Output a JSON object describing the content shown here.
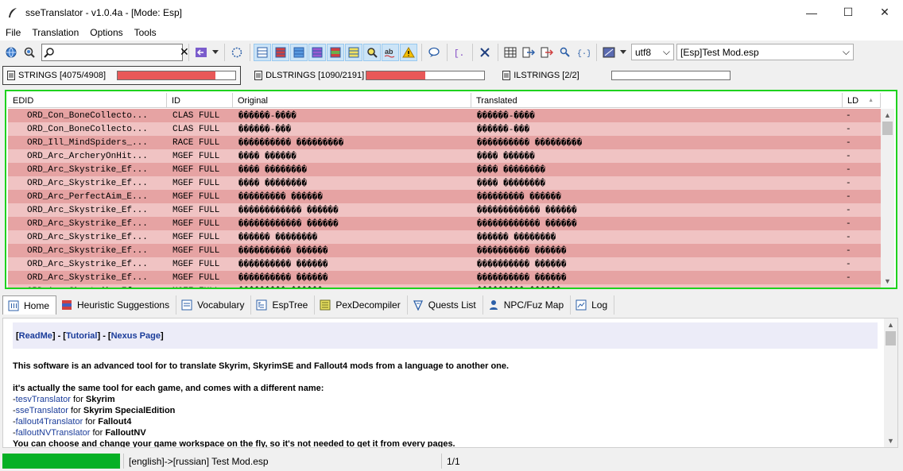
{
  "window": {
    "title": "sseTranslator - v1.0.4a - [Mode: Esp]",
    "min_glyph": "—",
    "max_glyph": "☐",
    "close_glyph": "✕"
  },
  "menu": [
    "File",
    "Translation",
    "Options",
    "Tools"
  ],
  "toolbar": {
    "search_value": "",
    "search_clear": "✕",
    "encoding": "utf8",
    "file": "[Esp]Test Mod.esp",
    "caret": "⌵",
    "icons": [
      "globe-icon",
      "search-settings-icon",
      "search-icon",
      "clear-icon",
      "back-icon",
      "dropdown-arrow-icon",
      "target-icon",
      "view-all-icon",
      "view-red-icon",
      "view-blue-icon",
      "view-purple-icon",
      "view-mixed-icon",
      "view-yellow-icon",
      "find-icon",
      "spellcheck-icon",
      "warning-icon",
      "comment-icon",
      "braces-icon",
      "delete-icon",
      "grid-icon",
      "import-icon",
      "export-icon",
      "user-search-icon",
      "code-icon",
      "theme-icon"
    ]
  },
  "string_tabs": [
    {
      "label": "STRINGS [4075/4908]",
      "progress": 0.83
    },
    {
      "label": "DLSTRINGS [1090/2191]",
      "progress": 0.5
    },
    {
      "label": "ILSTRINGS [2/2]",
      "progress": 0.0
    }
  ],
  "grid": {
    "columns": [
      "EDID",
      "ID",
      "Original",
      "Translated",
      "LD"
    ],
    "sort_glyph": "▲",
    "rows": [
      {
        "edid": "ORD_Con_BoneCollecto...",
        "id": "CLAS FULL",
        "orig": "������-����",
        "tr": "������-����",
        "ld": "-"
      },
      {
        "edid": "ORD_Con_BoneCollecto...",
        "id": "CLAS FULL",
        "orig": "������-���",
        "tr": "������-���",
        "ld": "-"
      },
      {
        "edid": "ORD_Ill_MindSpiders_...",
        "id": "RACE FULL",
        "orig": "���������� ���������",
        "tr": "���������� ���������",
        "ld": "-"
      },
      {
        "edid": "ORD_Arc_ArcheryOnHit...",
        "id": "MGEF FULL",
        "orig": "���� ������",
        "tr": "���� ������",
        "ld": "-"
      },
      {
        "edid": "ORD_Arc_Skystrike_Ef...",
        "id": "MGEF FULL",
        "orig": "���� ��������",
        "tr": "���� ��������",
        "ld": "-"
      },
      {
        "edid": "ORD_Arc_Skystrike_Ef...",
        "id": "MGEF FULL",
        "orig": "���� ��������",
        "tr": "���� ��������",
        "ld": "-"
      },
      {
        "edid": "ORD_Arc_PerfectAim_E...",
        "id": "MGEF FULL",
        "orig": "��������� ������",
        "tr": "��������� ������",
        "ld": "-"
      },
      {
        "edid": "ORD_Arc_Skystrike_Ef...",
        "id": "MGEF FULL",
        "orig": "������������ ������",
        "tr": "������������ ������",
        "ld": "-"
      },
      {
        "edid": "ORD_Arc_Skystrike_Ef...",
        "id": "MGEF FULL",
        "orig": "������������ ������",
        "tr": "������������ ������",
        "ld": "-"
      },
      {
        "edid": "ORD_Arc_Skystrike_Ef...",
        "id": "MGEF FULL",
        "orig": "������ ��������",
        "tr": "������ ��������",
        "ld": "-"
      },
      {
        "edid": "ORD_Arc_Skystrike_Ef...",
        "id": "MGEF FULL",
        "orig": "���������� ������",
        "tr": "���������� ������",
        "ld": "-"
      },
      {
        "edid": "ORD_Arc_Skystrike_Ef...",
        "id": "MGEF FULL",
        "orig": "���������� ������",
        "tr": "���������� ������",
        "ld": "-"
      },
      {
        "edid": "ORD_Arc_Skystrike_Ef...",
        "id": "MGEF FULL",
        "orig": "���������� ������",
        "tr": "���������� ������",
        "ld": "-"
      },
      {
        "edid": "ORD_Arc_Skystrike_Ef...",
        "id": "MGEF FULL",
        "orig": "��������� ������",
        "tr": "��������� ������",
        "ld": "-"
      }
    ]
  },
  "bottom_tabs": [
    "Home",
    "Heuristic Suggestions",
    "Vocabulary",
    "EspTree",
    "PexDecompiler",
    "Quests List",
    "NPC/Fuz Map",
    "Log"
  ],
  "doc": {
    "links": [
      "[",
      "ReadMe",
      "] - [",
      "Tutorial",
      "] - [",
      "Nexus Page",
      "]"
    ],
    "intro": "This software is an advanced tool for to translate Skyrim, SkyrimSE and Fallout4 mods from a language to another one.",
    "same_tool": "it's actually the same tool for each game, and comes with a different name:",
    "variants": [
      {
        "prefix": "-",
        "name": "tesvTranslator",
        "for": " for ",
        "game": "Skyrim"
      },
      {
        "prefix": "-",
        "name": "sseTranslator",
        "for": " for ",
        "game": "Skyrim SpecialEdition"
      },
      {
        "prefix": "-",
        "name": "fallout4Translator",
        "for": " for ",
        "game": "Fallout4"
      },
      {
        "prefix": "-",
        "name": "falloutNVTranslator",
        "for": " for ",
        "game": "FalloutNV"
      }
    ],
    "workspace": "You can choose and change your game workspace on the fly, so it's not needed to get it from every pages."
  },
  "status": {
    "lang": "[english]->[russian] Test Mod.esp",
    "pages": "1/1",
    "progress": 1.0
  }
}
